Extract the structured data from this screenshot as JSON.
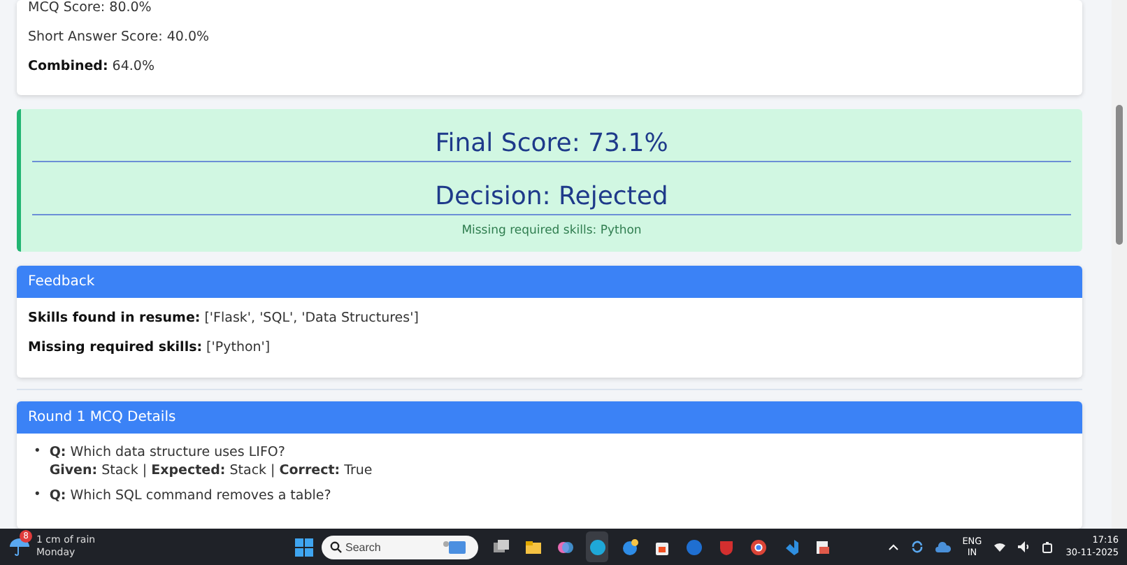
{
  "score_card": {
    "lines": [
      "MCQ Score: 80.0%",
      "Short Answer Score: 40.0%",
      "**Combined:** 64.0%"
    ]
  },
  "result": {
    "final_score": "Final Score: 73.1%",
    "decision": "Decision: Rejected",
    "note": "Missing required skills: Python"
  },
  "feedback": {
    "title": "Feedback",
    "lines": [
      "**Skills found in resume:** ['Flask', 'SQL', 'Data Structures']",
      "**Missing required skills:** ['Python']"
    ]
  },
  "mcq_details": {
    "title": "Round 1 MCQ Details",
    "items": [
      {
        "marker": "•",
        "question": "**Q:** Which data structure uses LIFO?",
        "answer": "**Given:** Stack | **Expected:** Stack | **Correct:** True"
      },
      {
        "marker": "•",
        "question": "**Q:** Which SQL command removes a table?"
      }
    ]
  },
  "taskbar": {
    "weather": {
      "badge": "8",
      "text": "1 cm of rain",
      "day": "Monday"
    },
    "search": {
      "placeholder": "Search"
    },
    "language": [
      "ENG",
      "IN"
    ],
    "time": "17:16",
    "date": "30-11-2025"
  }
}
